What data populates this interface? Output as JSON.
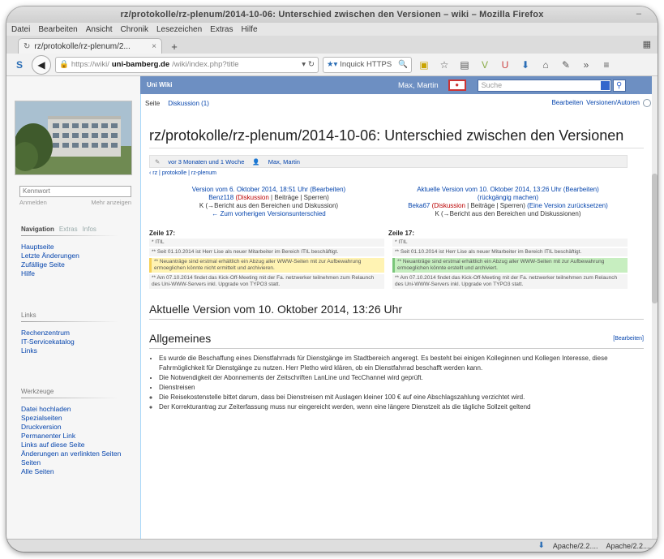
{
  "window": {
    "title": "rz/protokolle/rz-plenum/2014-10-06: Unterschied zwischen den Versionen – wiki – Mozilla Firefox"
  },
  "menubar": [
    "Datei",
    "Bearbeiten",
    "Ansicht",
    "Chronik",
    "Lesezeichen",
    "Extras",
    "Hilfe"
  ],
  "tab": {
    "label": "rz/protokolle/rz-plenum/2..."
  },
  "navbar": {
    "url_prefix": "https://wiki/",
    "url_host": "uni-bamberg.de",
    "url_path": "/wiki/index.php?title",
    "search_placeholder": "Inquick HTTPS"
  },
  "wikitop": {
    "brand": "Uni Wiki",
    "user": "Max, Martin",
    "search_placeholder": "Suche"
  },
  "sidebar": {
    "input_placeholder": "Kennwort",
    "input_links": [
      "Anmelden",
      "Mehr anzeigen"
    ],
    "nav_head": [
      "Navigation",
      "Extras",
      "Infos"
    ],
    "nav_items": [
      "Hauptseite",
      "Letzte Änderungen",
      "Zufällige Seite",
      "Hilfe"
    ],
    "links_head": "Links",
    "links_items": [
      "Rechenzentrum",
      "IT-Servicekatalog",
      "Links"
    ],
    "tools_head": "Werkzeuge",
    "tools_items": [
      "Datei hochladen",
      "Spezialseiten",
      "Druckversion",
      "Permanenter Link",
      "Links auf diese Seite",
      "Änderungen an verlinkten Seiten",
      "Seiten",
      "Alle Seiten"
    ]
  },
  "page_tabs": {
    "left": [
      "Seite",
      "Diskussion (1)"
    ],
    "right": [
      "Bearbeiten",
      "Versionen/Autoren"
    ]
  },
  "page": {
    "heading": "rz/protokolle/rz-plenum/2014-10-06: Unterschied zwischen den Versionen",
    "notice_time": "vor 3 Monaten und 1 Woche",
    "notice_user": "Max, Martin",
    "crumb": "‹ rz | protokolle | rz-plenum",
    "old_version": {
      "line1": "Version vom 6. Oktober 2014, 18:51 Uhr (Bearbeiten)",
      "line2a": "Benz118",
      "line2b": "(Diskussion",
      "line2c": "| Beiträge | Sperren)",
      "line3": "K (→Bericht aus den Bereichen und Diskussion)",
      "line4": "← Zum vorherigen Versionsunterschied"
    },
    "new_version": {
      "line1": "Aktuelle Version vom 10. Oktober 2014, 13:26 Uhr (Bearbeiten)",
      "line1b": "(rückgängig machen)",
      "line2a": "Beka67",
      "line2b": "(Diskussion",
      "line2c": "| Beiträge | Sperren)",
      "line2d": "(Eine Version zurücksetzen)",
      "line3": "K (→Bericht aus den Bereichen und Diskussionen)"
    },
    "zeile_left": "Zeile 17:",
    "zeile_right": "Zeile 17:",
    "diff_left": [
      "* ITIL",
      "** Seit 01.10.2014 ist Herr Lise als neuer Mitarbeiter im Bereich ITIL beschäftigt.",
      "** Neuanträge sind erstmal erhältlich ein Abzug aller WWW-Seiten mit zur Aufbewahrung ermoeglichen könnte nicht ermittelt und archivieren.",
      "** Am 07.10.2014 findet das Kick-Off-Meeting mit der Fa. netzwerker teilnehmen zum Relaunch des Uni-WWW-Servers inkl. Upgrade von TYPO3 statt."
    ],
    "diff_right": [
      "* ITIL",
      "** Seit 01.10.2014 ist Herr Lise als neuer Mitarbeiter im Bereich ITIL beschäftigt.",
      "** Neuanträge sind erstmal erhältlich ein Abzug aller WWW-Seiten mit zur Aufbewahrung ermoeglichen könnte erstellt und archiviert.",
      "** Am 07.10.2014 findet das Kick-Off-Meeting mit der Fa. netzwerker teilnehmen zum Relaunch des Uni-WWW-Servers inkl. Upgrade von TYPO3 statt."
    ],
    "current_heading": "Aktuelle Version vom 10. Oktober 2014, 13:26 Uhr",
    "section_heading": "Allgemeines",
    "section_edit": "[Bearbeiten]",
    "bullets": [
      "Es wurde die Beschaffung eines Dienstfahrrads für Dienstgänge im Stadtbereich angeregt. Es besteht bei einigen Kolleginnen und Kollegen Interesse, diese Fahrmöglichkeit für Dienstgänge zu nutzen. Herr Pletho wird klären, ob ein Dienstfahrrad beschafft werden kann.",
      "Die Notwendigkeit der Abonnements der Zeitschriften LanLine und TecChannel wird geprüft.",
      "Dienstreisen"
    ],
    "sub_bullets": [
      "Die Reisekostenstelle bittet darum, dass bei Dienstreisen mit Auslagen kleiner 100 € auf eine Abschlagszahlung verzichtet wird.",
      "Der Korrekturantrag zur Zeiterfassung muss nur eingereicht werden, wenn eine längere Dienstzeit als die tägliche Sollzeit geltend"
    ]
  },
  "statusbar": {
    "items": [
      "Apache/2.2....",
      "Apache/2.2...."
    ]
  }
}
